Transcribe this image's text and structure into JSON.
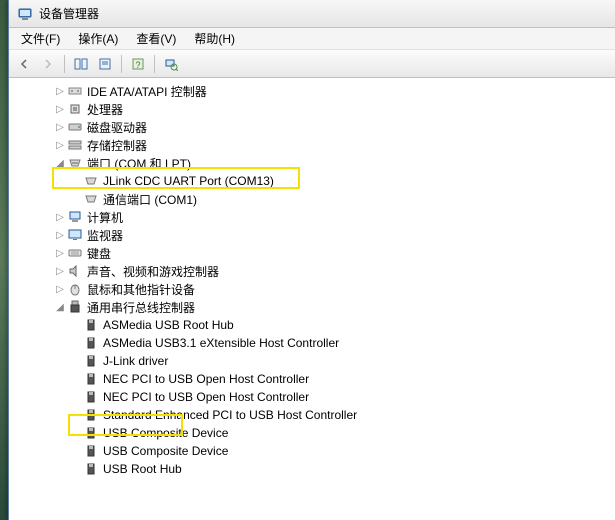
{
  "window_title": "设备管理器",
  "menubar": {
    "file": "文件(F)",
    "action": "操作(A)",
    "view": "查看(V)",
    "help": "帮助(H)"
  },
  "tree": {
    "ide": "IDE ATA/ATAPI 控制器",
    "cpu": "处理器",
    "disk": "磁盘驱动器",
    "storage": "存储控制器",
    "ports": "端口 (COM 和 LPT)",
    "port_jlink": "JLink CDC UART Port (COM13)",
    "port_com1": "通信端口 (COM1)",
    "computer": "计算机",
    "monitor": "监视器",
    "keyboard": "键盘",
    "sound": "声音、视频和游戏控制器",
    "mouse": "鼠标和其他指针设备",
    "usb": "通用串行总线控制器",
    "usb_asmedia_root": "ASMedia USB Root Hub",
    "usb_asmedia_xhci": "ASMedia USB3.1 eXtensible Host Controller",
    "usb_jlink": "J-Link driver",
    "usb_nec1": "NEC PCI to USB Open Host Controller",
    "usb_nec2": "NEC PCI to USB Open Host Controller",
    "usb_std": "Standard Enhanced PCI to USB Host Controller",
    "usb_comp1": "USB Composite Device",
    "usb_comp2": "USB Composite Device",
    "usb_root": "USB Root Hub"
  }
}
